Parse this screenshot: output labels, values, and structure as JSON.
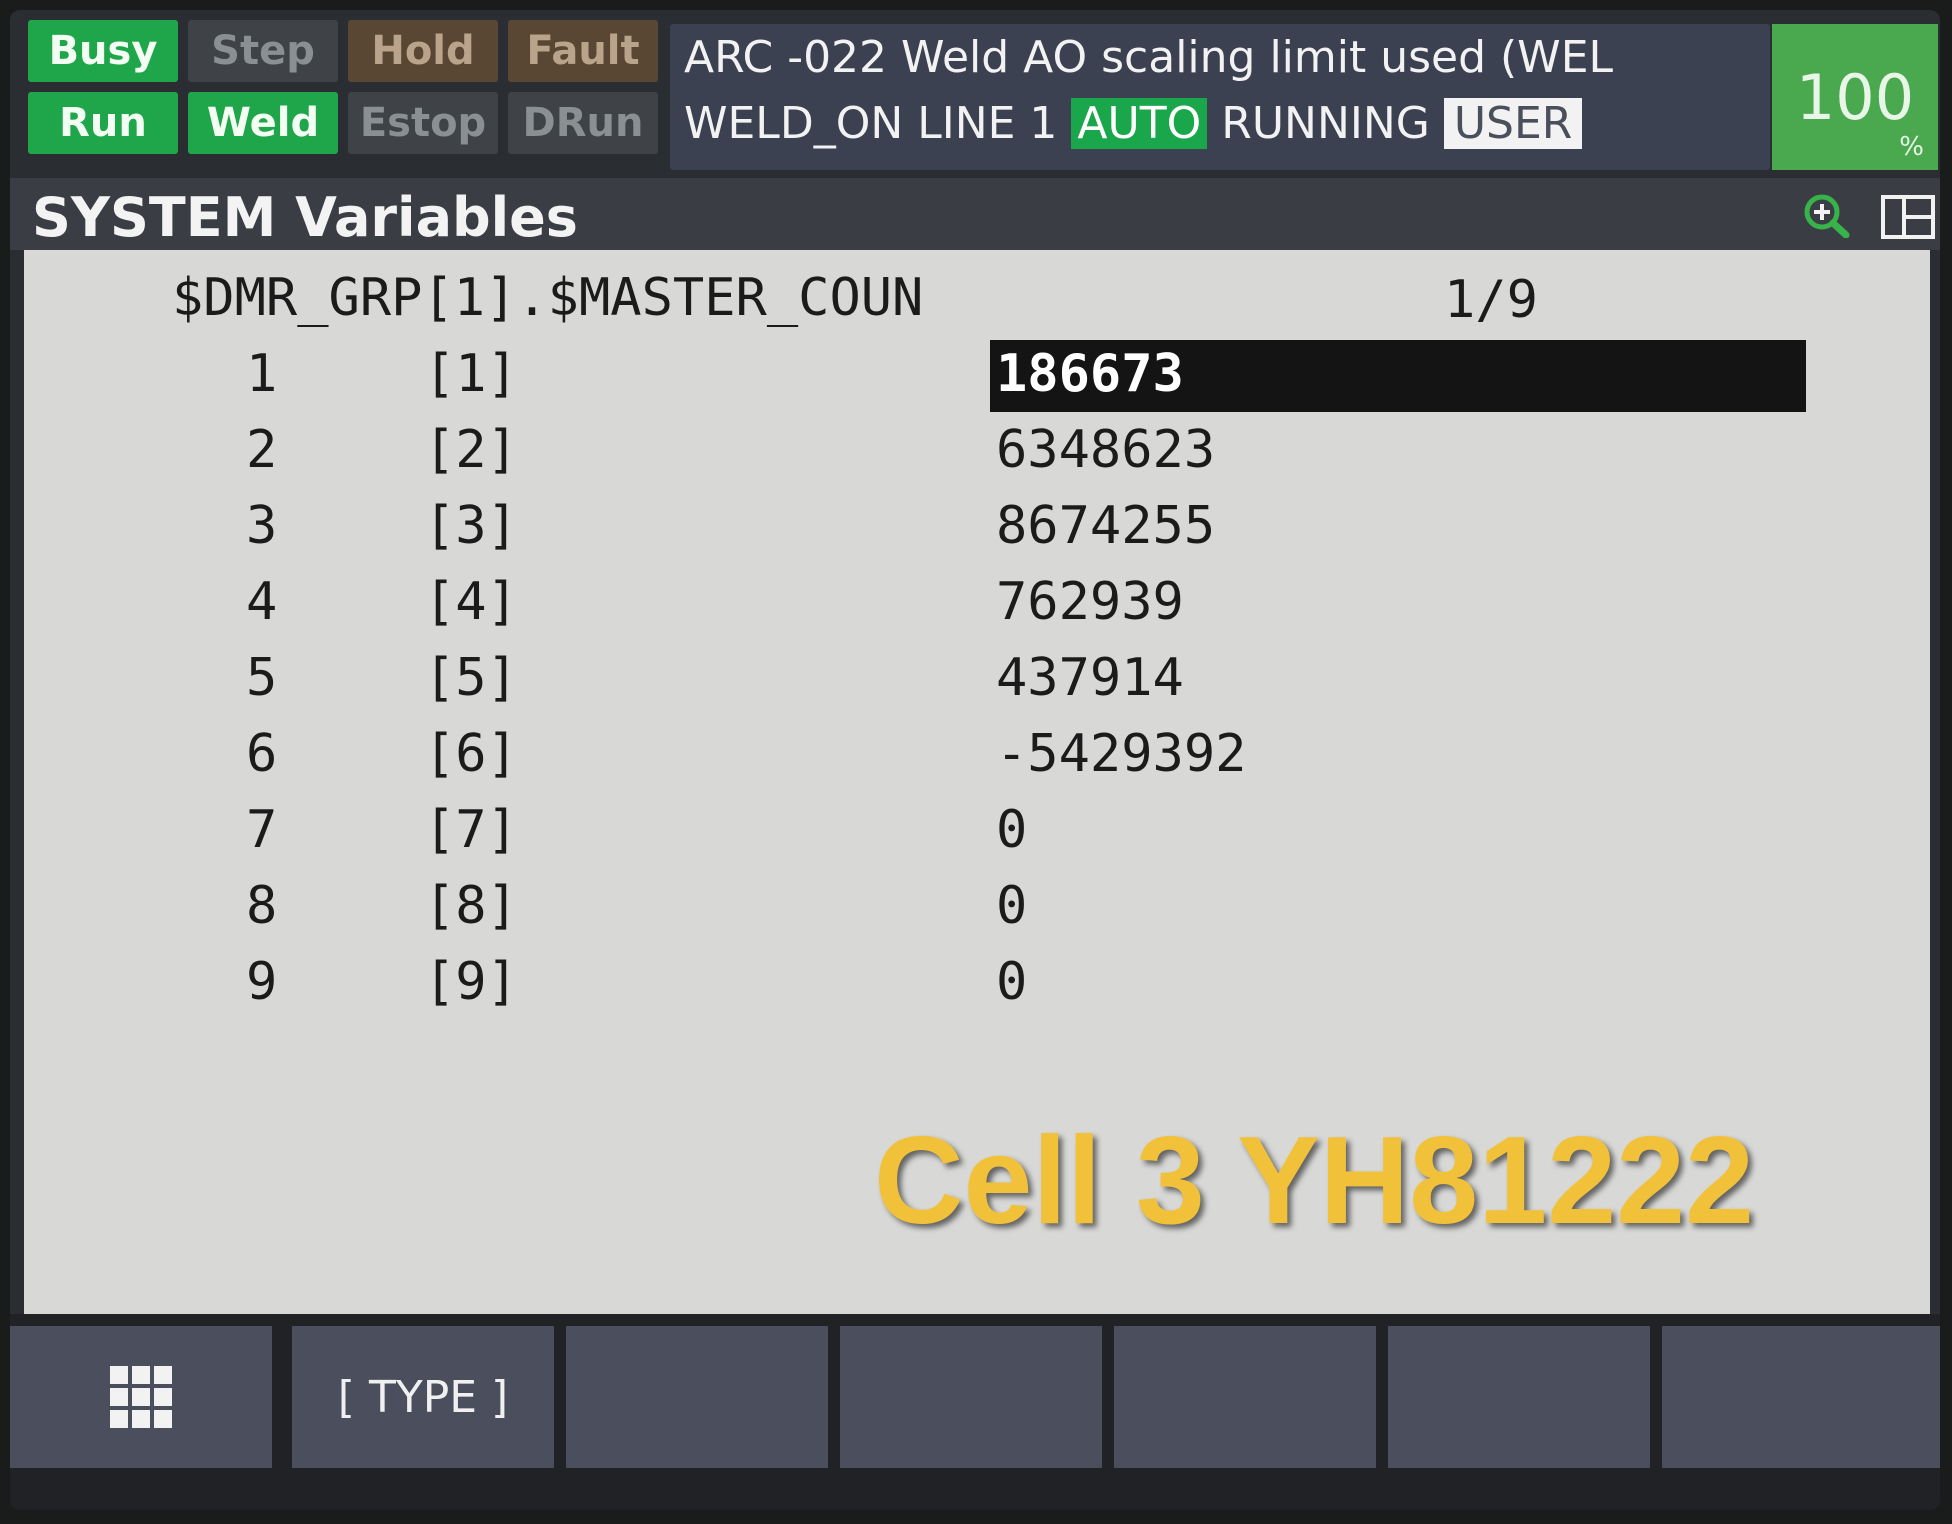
{
  "status": {
    "busy": "Busy",
    "step": "Step",
    "hold": "Hold",
    "fault": "Fault",
    "run": "Run",
    "weld": "Weld",
    "estop": "Estop",
    "drun": "DRun"
  },
  "message": {
    "line1": "ARC -022 Weld AO scaling limit used (WEL",
    "line2_program": "WELD_ON LINE 1",
    "mode": "AUTO",
    "state": "RUNNING",
    "user": "USER"
  },
  "override": {
    "value": "100",
    "unit": "%"
  },
  "title": "SYSTEM Variables",
  "variable": {
    "header": "$DMR_GRP[1].$MASTER_COUN",
    "page": "1/9",
    "rows": [
      {
        "num": "1",
        "index": "[1]",
        "value": "186673"
      },
      {
        "num": "2",
        "index": "[2]",
        "value": "6348623"
      },
      {
        "num": "3",
        "index": "[3]",
        "value": "8674255"
      },
      {
        "num": "4",
        "index": "[4]",
        "value": "762939"
      },
      {
        "num": "5",
        "index": "[5]",
        "value": "437914"
      },
      {
        "num": "6",
        "index": "[6]",
        "value": "-5429392"
      },
      {
        "num": "7",
        "index": "[7]",
        "value": "0"
      },
      {
        "num": "8",
        "index": "[8]",
        "value": "0"
      },
      {
        "num": "9",
        "index": "[9]",
        "value": "0"
      }
    ]
  },
  "overlay": "Cell 3 YH81222",
  "softkeys": {
    "type_label": "[ TYPE ]"
  },
  "icons": {
    "zoom": "zoom-in-icon",
    "split": "split-screen-icon",
    "menu": "grid-menu-icon"
  }
}
